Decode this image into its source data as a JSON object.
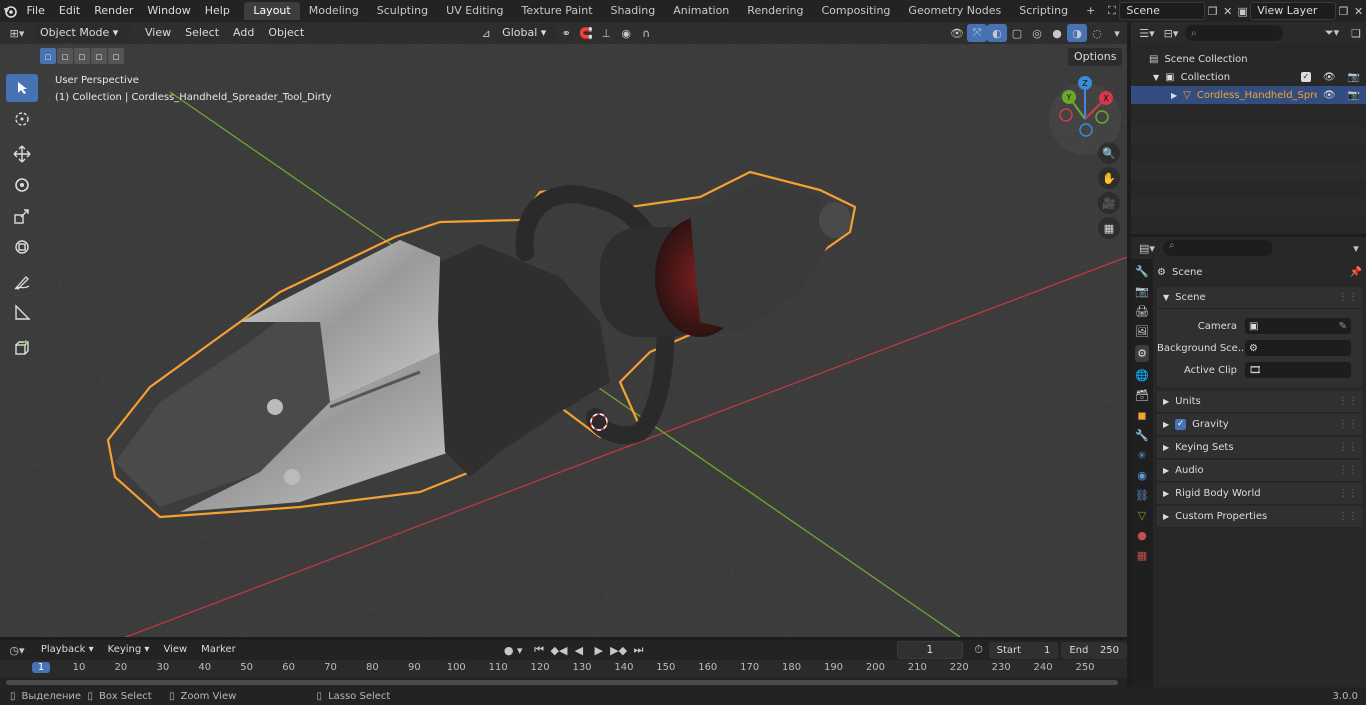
{
  "topbar": {
    "menus": [
      "File",
      "Edit",
      "Render",
      "Window",
      "Help"
    ],
    "workspaces": [
      "Layout",
      "Modeling",
      "Sculpting",
      "UV Editing",
      "Texture Paint",
      "Shading",
      "Animation",
      "Rendering",
      "Compositing",
      "Geometry Nodes",
      "Scripting"
    ],
    "active_workspace": "Layout",
    "add_tab": "+",
    "scene_name": "Scene",
    "view_layer": "View Layer"
  },
  "viewport": {
    "mode": "Object Mode",
    "menus": [
      "View",
      "Select",
      "Add",
      "Object"
    ],
    "orientation": "Global",
    "options_label": "Options",
    "overlay_title": "User Perspective",
    "overlay_subtitle": "(1) Collection | Cordless_Handheld_Spreader_Tool_Dirty",
    "gizmo": {
      "x": "X",
      "y": "Y",
      "z": "Z"
    }
  },
  "outliner": {
    "root": "Scene Collection",
    "collection": "Collection",
    "object": "Cordless_Handheld_Spre"
  },
  "properties": {
    "context": "Scene",
    "section": "Scene",
    "camera_label": "Camera",
    "bg_scene_label": "Background Sce...",
    "active_clip_label": "Active Clip",
    "panels": [
      "Units",
      "Gravity",
      "Keying Sets",
      "Audio",
      "Rigid Body World",
      "Custom Properties"
    ]
  },
  "timeline": {
    "menus": [
      "Playback",
      "Keying",
      "View",
      "Marker"
    ],
    "current_frame": "1",
    "start_label": "Start",
    "start_value": "1",
    "end_label": "End",
    "end_value": "250",
    "ruler": [
      "1",
      "10",
      "20",
      "30",
      "40",
      "50",
      "60",
      "70",
      "80",
      "90",
      "100",
      "110",
      "120",
      "130",
      "140",
      "150",
      "160",
      "170",
      "180",
      "190",
      "200",
      "210",
      "220",
      "230",
      "240",
      "250"
    ]
  },
  "statusbar": {
    "select": "Выделение",
    "box_select": "Box Select",
    "zoom_view": "Zoom View",
    "lasso_select": "Lasso Select",
    "version": "3.0.0"
  },
  "colors": {
    "accent": "#4772b3",
    "selection_outline": "#f5a033",
    "x_axis": "#d3394c",
    "y_axis": "#6ea82b",
    "z_axis": "#3a8bd8"
  }
}
